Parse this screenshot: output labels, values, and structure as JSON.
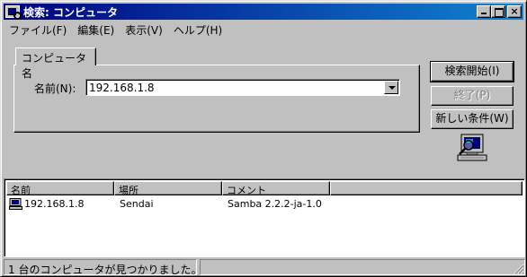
{
  "window": {
    "title": "検索: コンピュータ",
    "close_glyph": "×"
  },
  "menu": {
    "items": [
      "ファイル(F)",
      "編集(E)",
      "表示(V)",
      "ヘルプ(H)"
    ]
  },
  "search": {
    "tab_label": "コンピュータ名",
    "name_label": "名前(N):",
    "name_value": "192.168.1.8"
  },
  "buttons": {
    "start": "検索開始(I)",
    "stop": "終了(P)",
    "new_search": "新しい条件(W)"
  },
  "results": {
    "columns": [
      "名前",
      "場所",
      "コメント",
      ""
    ],
    "rows": [
      {
        "name": "192.168.1.8",
        "location": "Sendai",
        "comment": "Samba 2.2.2-ja-1.0"
      }
    ]
  },
  "status": {
    "message": "1 台のコンピュータが見つかりました。"
  },
  "icons": {
    "window_icon": "search-computer-icon",
    "large_icon": "computer-search-icon",
    "row_icon": "computer-icon"
  }
}
